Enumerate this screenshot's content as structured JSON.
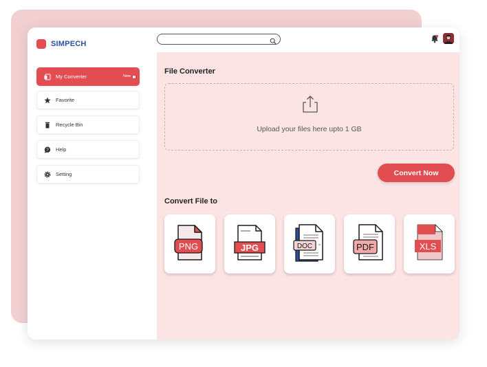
{
  "brand": {
    "name": "SIMPECH",
    "color": "#2a4f9e",
    "logo_color": "#e14d50"
  },
  "sidebar": {
    "items": [
      {
        "label": "My Converter",
        "badge": "New",
        "icon": "converter-icon",
        "active": true
      },
      {
        "label": "Favorite",
        "icon": "star-icon",
        "active": false
      },
      {
        "label": "Recycle Bin",
        "icon": "trash-icon",
        "active": false
      },
      {
        "label": "Help",
        "icon": "help-chat-icon",
        "active": false
      },
      {
        "label": "Setting",
        "icon": "gear-icon",
        "active": false
      }
    ]
  },
  "header": {
    "search": {
      "placeholder": "",
      "value": "",
      "icon": "search-icon"
    },
    "notifications_icon": "bell-icon",
    "avatar": "user-avatar"
  },
  "main": {
    "file_converter_title": "File Converter",
    "upload": {
      "icon": "upload-icon",
      "text": "Upload your files here upto 1 GB"
    },
    "convert_button": "Convert Now",
    "convert_to_title": "Convert File to",
    "formats": [
      {
        "label": "PNG",
        "icon": "png-file-icon"
      },
      {
        "label": "JPG",
        "icon": "jpg-file-icon"
      },
      {
        "label": "DOC",
        "icon": "doc-file-icon"
      },
      {
        "label": "PDF",
        "icon": "pdf-file-icon"
      },
      {
        "label": "XLS",
        "icon": "xls-file-icon"
      }
    ]
  },
  "colors": {
    "accent": "#e14d50",
    "main_bg": "#fde4e4",
    "backdrop": "#f2d0d2"
  }
}
